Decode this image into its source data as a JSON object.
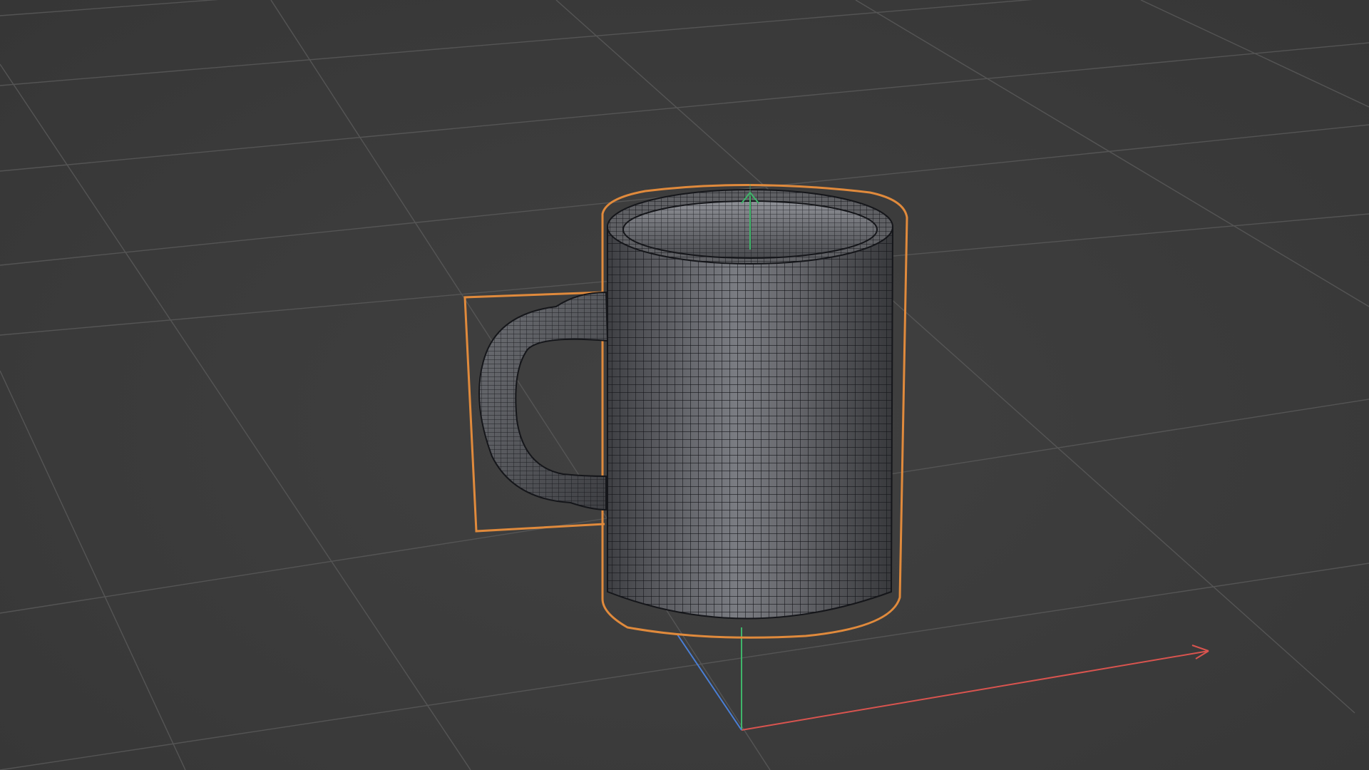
{
  "viewport": {
    "background_color": "#3b3b3b",
    "grid_color": "#5a5a5a",
    "grid_visible": true,
    "selected_object": "mug",
    "selection_outline_color": "#e08a3c",
    "display_mode": "wireframe-on-shaded"
  },
  "mug": {
    "surface_color": "#5e5f63",
    "wire_color": "#15161a"
  },
  "axes": {
    "x_color": "#d9544f",
    "y_color": "#3fb56a",
    "z_color": "#4a7fd6"
  },
  "icons": [
    "world-axis-gizmo-icon",
    "object-axis-gizmo-icon"
  ]
}
